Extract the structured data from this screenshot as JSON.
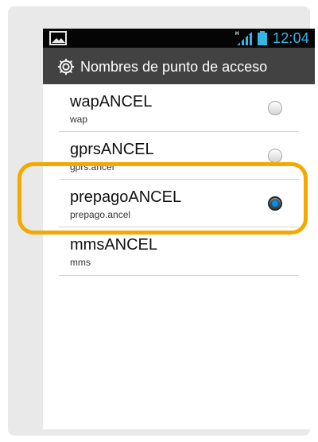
{
  "status_bar": {
    "left_icon": "image-icon",
    "signal_icon": "signal-h-icon",
    "battery_icon": "battery-icon",
    "time": "12:04"
  },
  "title_bar": {
    "icon": "settings-gear-icon",
    "title": "Nombres de punto de acceso"
  },
  "apn_list": {
    "items": [
      {
        "name": "wapANCEL",
        "value": "wap",
        "selected": false
      },
      {
        "name": "gprsANCEL",
        "value": "gprs.ancel",
        "selected": false
      },
      {
        "name": "prepagoANCEL",
        "value": "prepago.ancel",
        "selected": true
      },
      {
        "name": "mmsANCEL",
        "value": "mms",
        "selected": false
      }
    ]
  },
  "colors": {
    "frame": "#e9e9ea",
    "status_bar": "#050505",
    "accent_blue": "#35b5e5",
    "title_bar": "#424242",
    "highlight": "#f2a900",
    "radio_dot": "#0b8ee2"
  }
}
